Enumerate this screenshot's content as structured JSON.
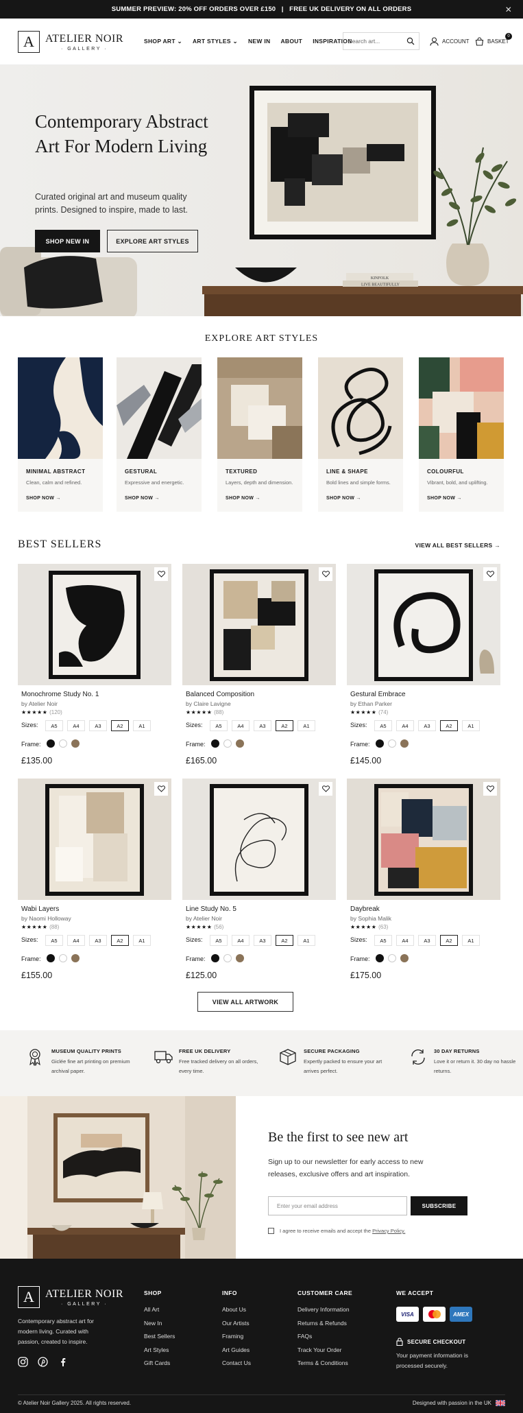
{
  "topbar": {
    "promo": "SUMMER PREVIEW: 20% OFF ORDERS OVER £150   |   FREE UK DELIVERY ON ALL ORDERS",
    "close": "✕"
  },
  "header": {
    "logo_mark": "A",
    "logo_name": "ATELIER NOIR",
    "logo_sub": "· GALLERY ·",
    "nav": [
      "SHOP ART",
      "ART STYLES",
      "NEW IN",
      "ABOUT",
      "INSPIRATION"
    ],
    "search_placeholder": "Search art...",
    "account": "ACCOUNT",
    "basket": "BASKET",
    "basket_count": "0"
  },
  "hero": {
    "title": "Contemporary Abstract Art For Modern Living",
    "subtitle": "Curated original art and museum quality prints. Designed to inspire, made to last.",
    "cta_primary": "SHOP NEW IN",
    "cta_secondary": "EXPLORE ART STYLES",
    "book1": "KINFOLK",
    "book2": "LIVE BEAUTIFULLY"
  },
  "explore": {
    "title": "EXPLORE ART STYLES",
    "styles": [
      {
        "name": "MINIMAL ABSTRACT",
        "desc": "Clean, calm and refined.",
        "cta": "SHOP NOW →"
      },
      {
        "name": "GESTURAL",
        "desc": "Expressive and energetic.",
        "cta": "SHOP NOW →"
      },
      {
        "name": "TEXTURED",
        "desc": "Layers, depth and dimension.",
        "cta": "SHOP NOW →"
      },
      {
        "name": "LINE & SHAPE",
        "desc": "Bold lines and simple forms.",
        "cta": "SHOP NOW →"
      },
      {
        "name": "COLOURFUL",
        "desc": "Vibrant, bold, and uplifting.",
        "cta": "SHOP NOW →"
      }
    ]
  },
  "bestsellers": {
    "title": "BEST SELLERS",
    "view_all": "VIEW ALL BEST SELLERS →",
    "sizes_label": "Sizes:",
    "frame_label": "Frame:",
    "sizes": [
      "A5",
      "A4",
      "A3",
      "A2",
      "A1"
    ],
    "selected_size": "A2",
    "frame_colors": [
      "#111111",
      "#ffffff",
      "#8a7358"
    ],
    "products": [
      {
        "name": "Monochrome Study No. 1",
        "artist": "by Atelier Noir",
        "stars": "★★★★★",
        "reviews": "(120)",
        "price": "£135.00"
      },
      {
        "name": "Balanced Composition",
        "artist": "by Claire Lavigne",
        "stars": "★★★★★",
        "reviews": "(88)",
        "price": "£165.00"
      },
      {
        "name": "Gestural Embrace",
        "artist": "by Ethan Parker",
        "stars": "★★★★★",
        "reviews": "(74)",
        "price": "£145.00"
      },
      {
        "name": "Wabi Layers",
        "artist": "by Naomi Holloway",
        "stars": "★★★★★",
        "reviews": "(88)",
        "price": "£155.00"
      },
      {
        "name": "Line Study No. 5",
        "artist": "by Atelier Noir",
        "stars": "★★★★★",
        "reviews": "(56)",
        "price": "£125.00"
      },
      {
        "name": "Daybreak",
        "artist": "by Sophia Malik",
        "stars": "★★★★★",
        "reviews": "(63)",
        "price": "£175.00"
      }
    ],
    "view_all_artwork": "VIEW ALL ARTWORK"
  },
  "features": [
    {
      "title": "MUSEUM QUALITY PRINTS",
      "desc": "Giclée fine art printing on premium archival paper."
    },
    {
      "title": "FREE UK DELIVERY",
      "desc": "Free tracked delivery on all orders, every time."
    },
    {
      "title": "SECURE PACKAGING",
      "desc": "Expertly packed to ensure your art arrives perfect."
    },
    {
      "title": "30 DAY RETURNS",
      "desc": "Love it or return it. 30 day no hassle returns."
    }
  ],
  "newsletter": {
    "title": "Be the first to see new art",
    "desc": "Sign up to our newsletter for early access to new releases, exclusive offers and art inspiration.",
    "placeholder": "Enter your email address",
    "button": "SUBSCRIBE",
    "agree": "I agree to receive emails and accept the",
    "policy": "Privacy Policy."
  },
  "footer": {
    "desc": "Contemporary abstract art for modern living. Curated with passion, created to inspire.",
    "columns": [
      {
        "title": "SHOP",
        "items": [
          "All Art",
          "New In",
          "Best Sellers",
          "Art Styles",
          "Gift Cards"
        ]
      },
      {
        "title": "INFO",
        "items": [
          "About Us",
          "Our Artists",
          "Framing",
          "Art Guides",
          "Contact Us"
        ]
      },
      {
        "title": "CUSTOMER CARE",
        "items": [
          "Delivery Information",
          "Returns & Refunds",
          "FAQs",
          "Track Your Order",
          "Terms & Conditions"
        ]
      }
    ],
    "accept_title": "WE ACCEPT",
    "cards": [
      "VISA",
      "",
      "AMEX"
    ],
    "secure_title": "SECURE CHECKOUT",
    "secure_desc": "Your payment information is processed securely.",
    "copyright": "© Atelier Noir Gallery 2025. All rights reserved.",
    "made": "Designed with passion in the UK"
  }
}
